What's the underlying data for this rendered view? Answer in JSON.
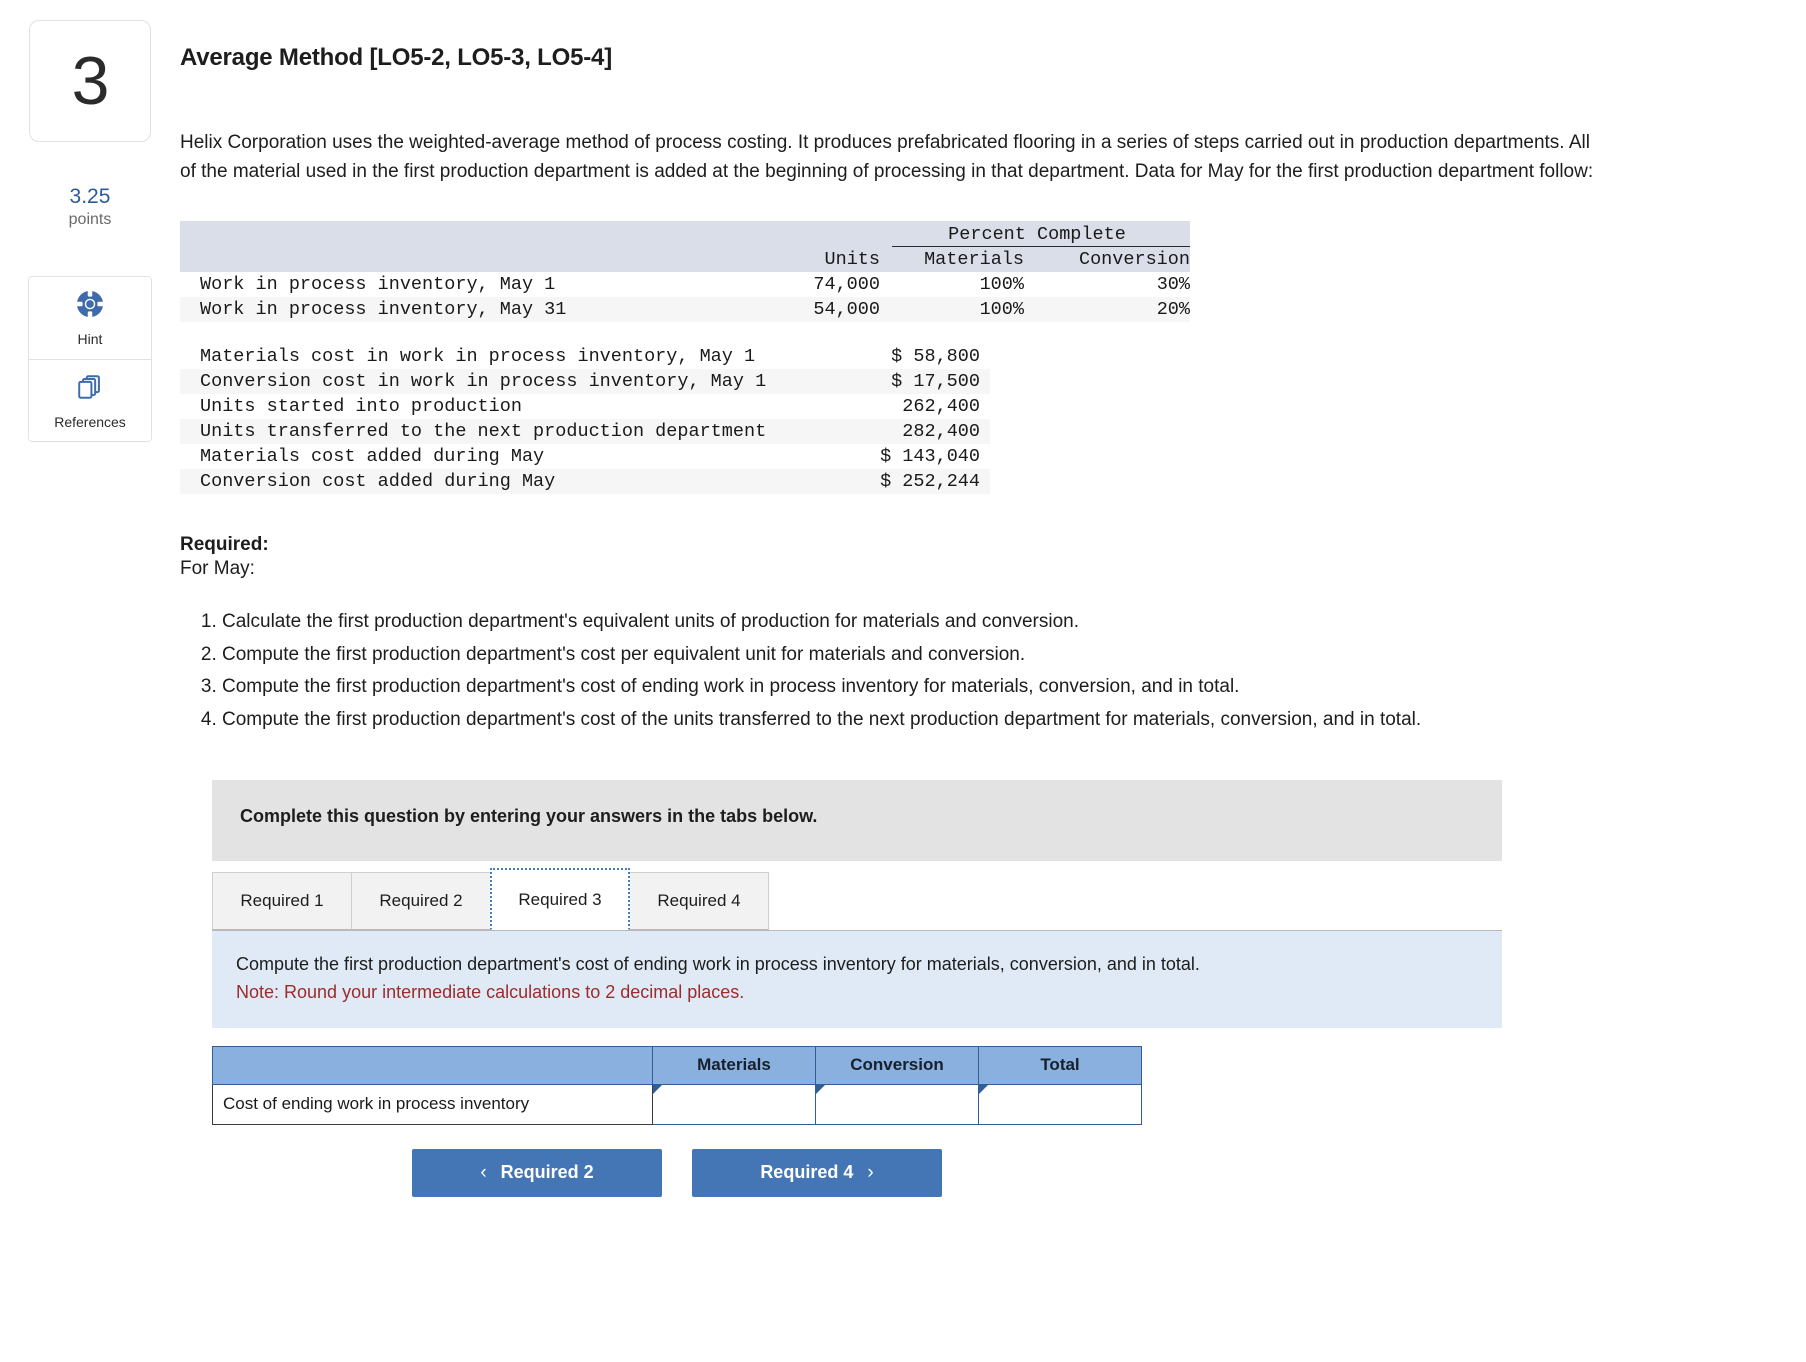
{
  "question": {
    "number": "3",
    "points_value": "3.25",
    "points_label": "points",
    "title": "Average Method [LO5-2, LO5-3, LO5-4]",
    "intro": "Helix Corporation uses the weighted-average method of process costing. It produces prefabricated flooring in a series of steps carried out in production departments. All of the material used in the first production department is added at the beginning of processing in that department. Data for May for the first production department follow:"
  },
  "tools": [
    {
      "label": "Hint",
      "icon": "lifebuoy-icon"
    },
    {
      "label": "References",
      "icon": "documents-icon"
    }
  ],
  "data_table": {
    "group_header": "Percent Complete",
    "columns": [
      "",
      "Units",
      "Materials",
      "Conversion"
    ],
    "unit_rows": [
      {
        "label": "Work in process inventory, May 1",
        "units": "74,000",
        "materials": "100%",
        "conversion": "30%"
      },
      {
        "label": "Work in process inventory, May 31",
        "units": "54,000",
        "materials": "100%",
        "conversion": "20%"
      }
    ],
    "cost_rows": [
      {
        "label": "Materials cost in work in process inventory, May 1",
        "value": "$ 58,800"
      },
      {
        "label": "Conversion cost in work in process inventory, May 1",
        "value": "$ 17,500"
      },
      {
        "label": "Units started into production",
        "value": "262,400"
      },
      {
        "label": "Units transferred to the next production department",
        "value": "282,400"
      },
      {
        "label": "Materials cost added during May",
        "value": "$ 143,040"
      },
      {
        "label": "Conversion cost added during May",
        "value": "$ 252,244"
      }
    ]
  },
  "required": {
    "heading": "Required:",
    "subheading": "For May:",
    "items": [
      "Calculate the first production department's equivalent units of production for materials and conversion.",
      "Compute the first production department's cost per equivalent unit for materials and conversion.",
      "Compute the first production department's cost of ending work in process inventory for materials, conversion, and in total.",
      "Compute the first production department's cost of the units transferred to the next production department for materials, conversion, and in total."
    ]
  },
  "widget": {
    "banner": "Complete this question by entering your answers in the tabs below.",
    "tabs": [
      {
        "label": "Required 1",
        "active": false
      },
      {
        "label": "Required 2",
        "active": false
      },
      {
        "label": "Required 3",
        "active": true
      },
      {
        "label": "Required 4",
        "active": false
      }
    ],
    "instruction": "Compute the first production department's cost of ending work in process inventory for materials, conversion, and in total.",
    "note": "Note: Round your intermediate calculations to 2 decimal places.",
    "answer_table": {
      "headers": [
        "",
        "Materials",
        "Conversion",
        "Total"
      ],
      "rows": [
        {
          "label": "Cost of ending work in process inventory",
          "materials": "",
          "conversion": "",
          "total": ""
        }
      ]
    },
    "nav": {
      "prev_label": "Required 2",
      "prev_chevron": "‹",
      "next_label": "Required 4",
      "next_chevron": "›"
    }
  },
  "colors": {
    "accent_blue": "#4476b5",
    "table_header_blue": "#8ab0df",
    "instruction_bg": "#dfeaf6",
    "note_red": "#9c2b2b",
    "mono_header_bg": "#d9dee8"
  }
}
